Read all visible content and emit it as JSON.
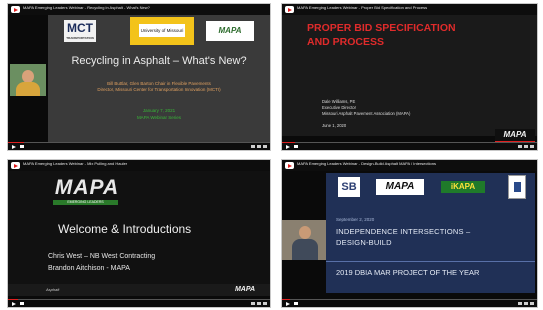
{
  "players": [
    {
      "title": "MAPA Emerging Leaders Webinar - Recycling in Asphalt - What's New?",
      "subtitle": "",
      "time": "",
      "progress": 0.06,
      "slide": {
        "logo_left": "MCT",
        "logo_left_sub": "TRANSPORTATION",
        "logo_center": "University of Missouri",
        "logo_right": "MAPA",
        "title": "Recycling in Asphalt – What's New?",
        "body_lines": [
          "Bill Buttlar, Glen Barton Chair in Flexible Pavements",
          "Director, Missouri Center for Transportation Innovation (MCTI)"
        ],
        "footer_lines": [
          "January 7, 2021",
          "MAPA Webinar Series"
        ]
      }
    },
    {
      "title": "MAPA Emerging Leaders Webinar - Proper Bid Specification and Process",
      "subtitle": "",
      "time": "",
      "progress": 0.05,
      "slide": {
        "title_lines": [
          "PROPER BID SPECIFICATION",
          "AND PROCESS"
        ],
        "body_lines": [
          "Dale Williams, PE",
          "Executive Director",
          "Missouri Asphalt Pavement Association (MAPA)",
          "",
          "June 1, 2020"
        ],
        "logo": "MAPA"
      }
    },
    {
      "title": "MAPA Emerging Leaders Webinar - Mix Pulling and Hauler",
      "subtitle": "",
      "time": "",
      "progress": 0.04,
      "slide": {
        "logo": "MAPA",
        "tagline": "EMERGING LEADERS",
        "heading": "Welcome & Introductions",
        "line1": "Chris West – NB West Contracting",
        "line2": "Brandon Aitchison - MAPA",
        "footer_left": "Asphalt",
        "footer_logo": "MAPA"
      }
    },
    {
      "title": "MAPA Emerging Leaders Webinar - Design-Build Asphalt MAPA / Intersections",
      "subtitle": "",
      "time": "",
      "progress": 0.03,
      "slide": {
        "logo_sb": "SB",
        "logo_mapa": "MAPA",
        "logo_ikapa": "iKAPA",
        "date": "September 2, 2020",
        "title_line1": "INDEPENDENCE INTERSECTIONS –",
        "title_line2": "DESIGN-BUILD",
        "bottom": "2019 DBIA MAR PROJECT OF THE YEAR"
      }
    }
  ]
}
